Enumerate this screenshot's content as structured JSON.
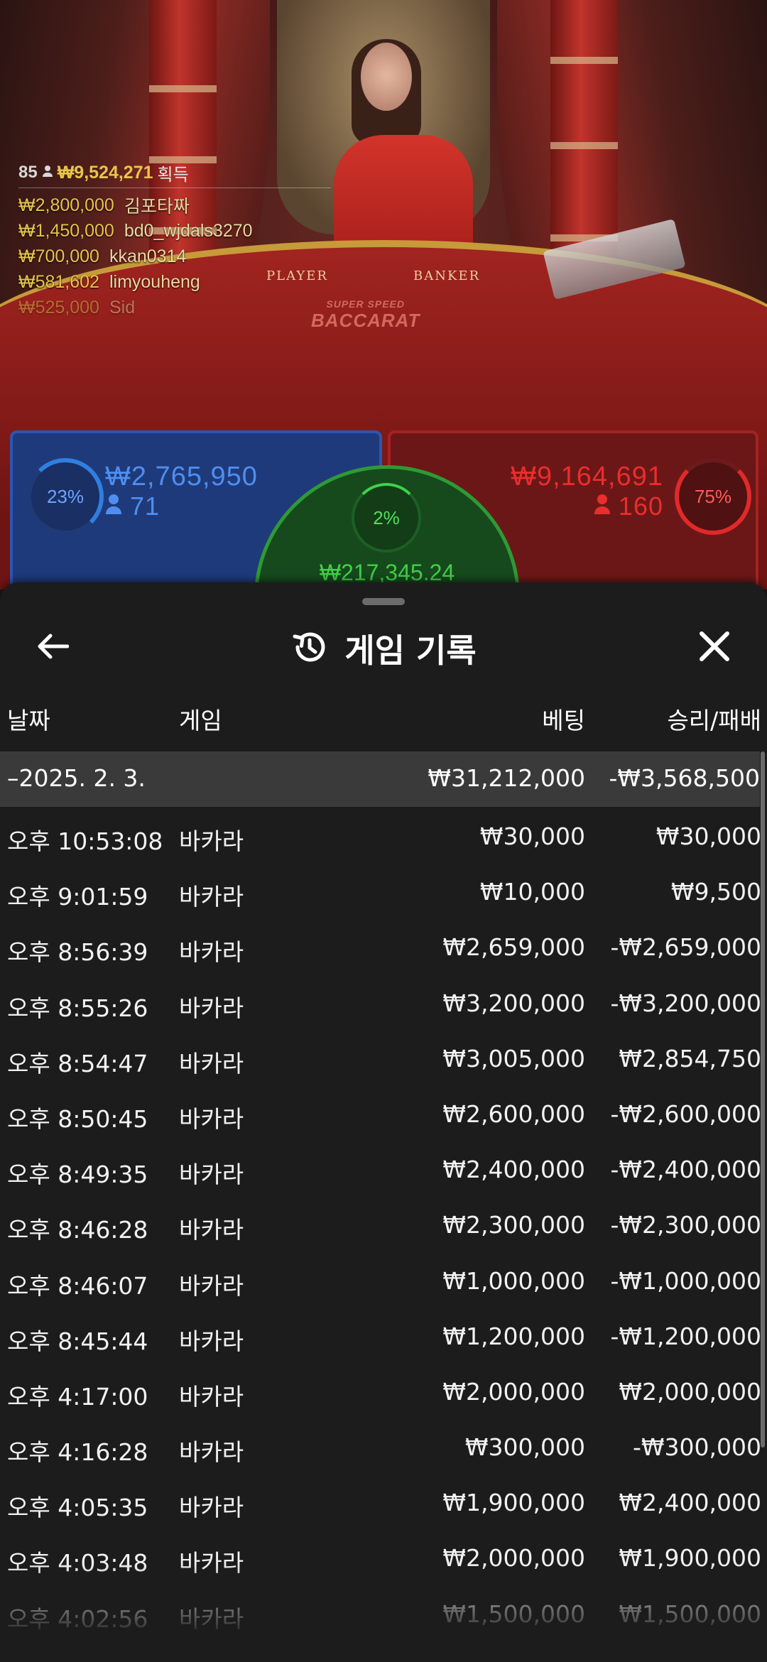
{
  "stream": {
    "felt_player": "PLAYER",
    "felt_banker": "BANKER",
    "felt_logo_small": "SUPER SPEED",
    "felt_logo_big": "BACCARAT"
  },
  "winners": {
    "count": "85",
    "total": "₩9,524,271",
    "label": "획득",
    "rows": [
      {
        "amount": "₩2,800,000",
        "name": "김포타짜"
      },
      {
        "amount": "₩1,450,000",
        "name": "bd0_wjdals3270"
      },
      {
        "amount": "₩700,000",
        "name": "kkan0314"
      },
      {
        "amount": "₩581,602",
        "name": "limyouheng"
      },
      {
        "amount": "₩525,000",
        "name": "Sid"
      }
    ]
  },
  "bets": {
    "player": {
      "percent": "23%",
      "amount": "₩2,765,950",
      "count": "71",
      "fraction": 0.23,
      "color": "#2f7fe0"
    },
    "banker": {
      "percent": "75%",
      "amount": "₩9,164,691",
      "count": "160",
      "fraction": 0.75,
      "color": "#e02a2a"
    },
    "tie": {
      "percent": "2%",
      "amount": "₩217,345.24",
      "fraction": 0.02,
      "color": "#3ed24a"
    }
  },
  "sheet": {
    "title": "게임 기록",
    "back_icon": "arrow-left-icon",
    "history_icon": "history-icon",
    "close_icon": "close-icon",
    "headers": {
      "date": "날짜",
      "game": "게임",
      "bet": "베팅",
      "result": "승리/패배"
    },
    "day": {
      "date": "–2025. 2. 3.",
      "bet": "₩31,212,000",
      "result": "-₩3,568,500"
    },
    "rows": [
      {
        "time": "오후 10:53:08",
        "game": "바카라",
        "bet": "₩30,000",
        "result": "₩30,000"
      },
      {
        "time": "오후 9:01:59",
        "game": "바카라",
        "bet": "₩10,000",
        "result": "₩9,500"
      },
      {
        "time": "오후 8:56:39",
        "game": "바카라",
        "bet": "₩2,659,000",
        "result": "-₩2,659,000"
      },
      {
        "time": "오후 8:55:26",
        "game": "바카라",
        "bet": "₩3,200,000",
        "result": "-₩3,200,000"
      },
      {
        "time": "오후 8:54:47",
        "game": "바카라",
        "bet": "₩3,005,000",
        "result": "₩2,854,750"
      },
      {
        "time": "오후 8:50:45",
        "game": "바카라",
        "bet": "₩2,600,000",
        "result": "-₩2,600,000"
      },
      {
        "time": "오후 8:49:35",
        "game": "바카라",
        "bet": "₩2,400,000",
        "result": "-₩2,400,000"
      },
      {
        "time": "오후 8:46:28",
        "game": "바카라",
        "bet": "₩2,300,000",
        "result": "-₩2,300,000"
      },
      {
        "time": "오후 8:46:07",
        "game": "바카라",
        "bet": "₩1,000,000",
        "result": "-₩1,000,000"
      },
      {
        "time": "오후 8:45:44",
        "game": "바카라",
        "bet": "₩1,200,000",
        "result": "-₩1,200,000"
      },
      {
        "time": "오후 4:17:00",
        "game": "바카라",
        "bet": "₩2,000,000",
        "result": "₩2,000,000"
      },
      {
        "time": "오후 4:16:28",
        "game": "바카라",
        "bet": "₩300,000",
        "result": "-₩300,000"
      },
      {
        "time": "오후 4:05:35",
        "game": "바카라",
        "bet": "₩1,900,000",
        "result": "₩2,400,000"
      },
      {
        "time": "오후 4:03:48",
        "game": "바카라",
        "bet": "₩2,000,000",
        "result": "₩1,900,000"
      },
      {
        "time": "오후 4:02:56",
        "game": "바카라",
        "bet": "₩1,500,000",
        "result": "₩1,500,000"
      }
    ]
  }
}
